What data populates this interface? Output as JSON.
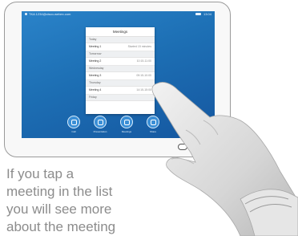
{
  "screen": {
    "status_left": "TKA 1234@cisco-webex.com",
    "status_right": "13:04"
  },
  "meetings": {
    "title": "Meetings",
    "groups": [
      {
        "day": "Today",
        "items": [
          {
            "name": "Meeting 1",
            "time": "Started 15 minutes"
          }
        ]
      },
      {
        "day": "Tomorrow",
        "items": [
          {
            "name": "Meeting 2",
            "time": "10:15-11:00"
          }
        ]
      },
      {
        "day": "Wednesday",
        "items": [
          {
            "name": "Meeting 3",
            "time": "09:15-10:00"
          }
        ]
      },
      {
        "day": "Thursday",
        "items": [
          {
            "name": "Meeting 4",
            "time": "14:15-15:00"
          }
        ]
      },
      {
        "day": "Friday",
        "items": []
      }
    ]
  },
  "dock": {
    "items": [
      {
        "label": "Call"
      },
      {
        "label": "Presentation"
      },
      {
        "label": "Meetings"
      },
      {
        "label": "Share"
      }
    ]
  },
  "caption": {
    "line1": "If you tap a",
    "line2": "meeting in the list",
    "line3": "you will see more",
    "line4": "about the meeting"
  }
}
